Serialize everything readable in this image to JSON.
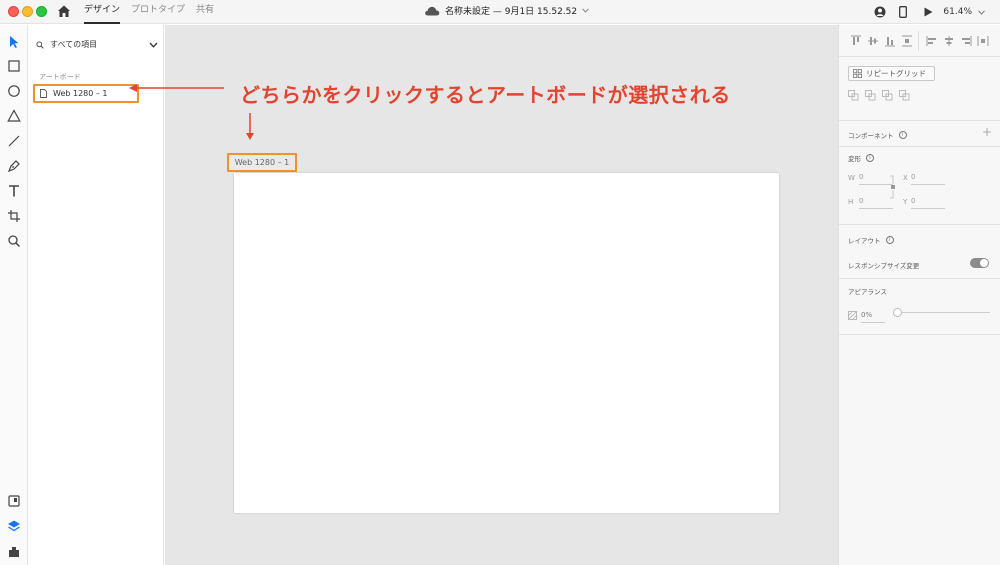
{
  "titlebar": {
    "tabs": [
      "デザイン",
      "プロトタイプ",
      "共有"
    ],
    "active_tab": "デザイン",
    "document_title": "名称未設定 — 9月1日 15.52.52",
    "zoom": "61.4%"
  },
  "toolbar": {
    "tools": [
      "select-tool-icon",
      "rectangle-tool-icon",
      "ellipse-tool-icon",
      "polygon-tool-icon",
      "line-tool-icon",
      "pen-tool-icon",
      "text-tool-icon",
      "artboard-tool-icon",
      "zoom-tool-icon"
    ],
    "bottom": [
      "assets-icon",
      "layers-icon",
      "plugins-icon"
    ]
  },
  "layers": {
    "filter_label": "すべての項目",
    "section_heading": "アートボード",
    "items": [
      {
        "label": "Web 1280 – 1"
      }
    ]
  },
  "canvas": {
    "artboard_label": "Web 1280 – 1",
    "annotation": "どちらかをクリックするとアートボードが選択される",
    "annotation_color": "#e2442f",
    "highlight_color": "#f0912a"
  },
  "properties": {
    "repeat_grid": "リピートグリッド",
    "component": "コンポーネント",
    "transform": "変形",
    "fields": {
      "w_label": "W",
      "w_value": "0",
      "x_label": "X",
      "x_value": "0",
      "h_label": "H",
      "h_value": "0",
      "y_label": "Y",
      "y_value": "0"
    },
    "layout": "レイアウト",
    "responsive_resize": "レスポンシブサイズ変更",
    "appearance": "アピアランス",
    "opacity": "0%"
  }
}
